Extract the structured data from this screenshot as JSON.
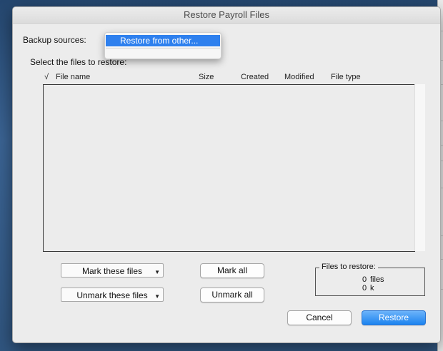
{
  "dialog": {
    "title": "Restore Payroll Files"
  },
  "backup": {
    "label": "Backup sources:",
    "menu_items": [
      "Restore from other...",
      ""
    ]
  },
  "files": {
    "instruction": "Select the files to restore:",
    "columns": {
      "check": "√",
      "name": "File name",
      "size": "Size",
      "created": "Created",
      "modified": "Modified",
      "type": "File type"
    },
    "rows": []
  },
  "actions": {
    "mark_these": "Mark these files",
    "unmark_these": "Unmark these files",
    "mark_all": "Mark all",
    "unmark_all": "Unmark all"
  },
  "summary": {
    "title": "Files to restore:",
    "files_count": "0",
    "files_unit": "files",
    "size_count": "0",
    "size_unit": "k"
  },
  "footer": {
    "cancel": "Cancel",
    "restore": "Restore"
  },
  "colors": {
    "accent": "#2e80ee",
    "primary_button": "#1c83ef"
  }
}
